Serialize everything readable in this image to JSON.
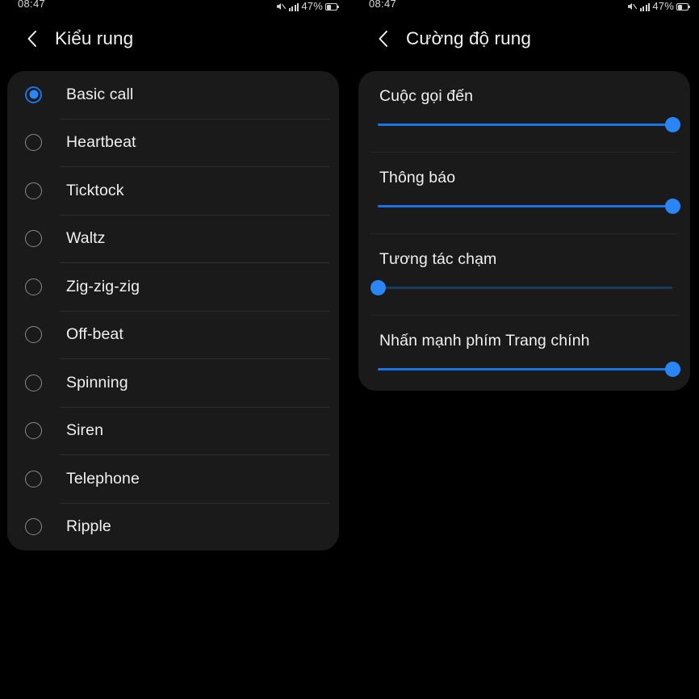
{
  "theme": {
    "page_bg": "#000000",
    "card_bg": "#1a1a1a",
    "accent": "#1a73e8",
    "thumb": "#2a86f5",
    "text": "#f0f0f0",
    "divider": "#2f2f2f",
    "inactive_track": "#1c3c66"
  },
  "status_bar": {
    "time": "08:47",
    "battery_percent": "47%",
    "icons": [
      "mute-icon",
      "signal-icon",
      "battery-icon"
    ]
  },
  "left_screen": {
    "back_icon": "chevron-left-icon",
    "title": "Kiểu rung",
    "options": [
      {
        "label": "Basic call",
        "selected": true
      },
      {
        "label": "Heartbeat",
        "selected": false
      },
      {
        "label": "Ticktock",
        "selected": false
      },
      {
        "label": "Waltz",
        "selected": false
      },
      {
        "label": "Zig-zig-zig",
        "selected": false
      },
      {
        "label": "Off-beat",
        "selected": false
      },
      {
        "label": "Spinning",
        "selected": false
      },
      {
        "label": "Siren",
        "selected": false
      },
      {
        "label": "Telephone",
        "selected": false
      },
      {
        "label": "Ripple",
        "selected": false
      }
    ]
  },
  "right_screen": {
    "back_icon": "chevron-left-icon",
    "title": "Cường độ rung",
    "sliders": [
      {
        "label": "Cuộc gọi đến",
        "value": 100
      },
      {
        "label": "Thông báo",
        "value": 100
      },
      {
        "label": "Tương tác chạm",
        "value": 0
      },
      {
        "label": "Nhấn mạnh phím Trang chính",
        "value": 100
      }
    ]
  }
}
